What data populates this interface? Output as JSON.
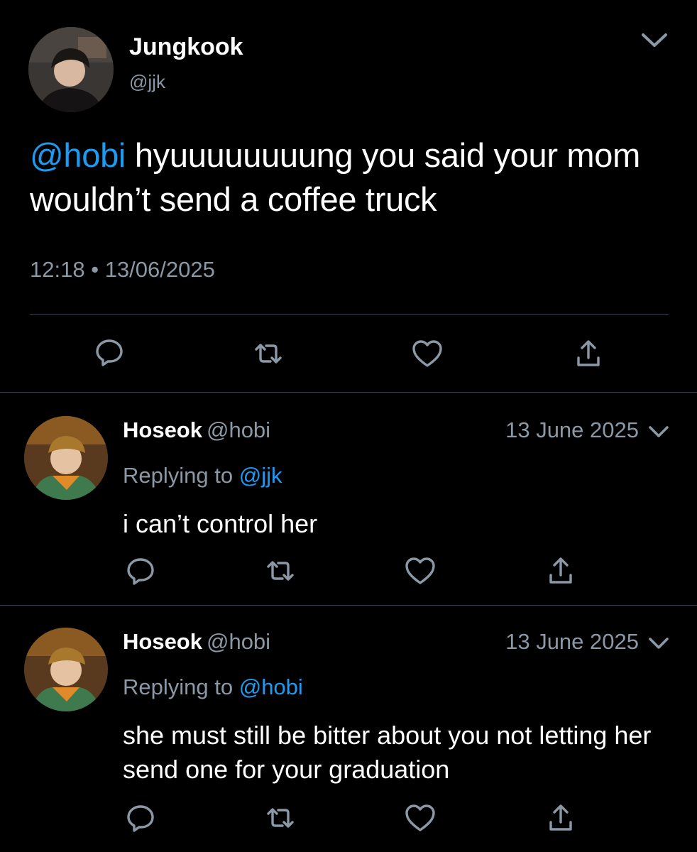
{
  "main_tweet": {
    "display_name": "Jungkook",
    "handle": "@jjk",
    "mention": "@hobi",
    "text_rest": " hyuuuuuuuung you said your mom wouldn’t send a coffee truck",
    "time": "12:18",
    "separator": "•",
    "date": "13/06/2025",
    "menu_icon": "chevron-down-icon",
    "actions": [
      "reply-icon",
      "retweet-icon",
      "like-icon",
      "share-icon"
    ]
  },
  "replies": [
    {
      "display_name": "Hoseok",
      "handle": "@hobi",
      "date": "13 June 2025",
      "replying_label": "Replying to",
      "replying_to": "@jjk",
      "text": "i can’t control her"
    },
    {
      "display_name": "Hoseok",
      "handle": "@hobi",
      "date": "13 June 2025",
      "replying_label": "Replying to",
      "replying_to": "@hobi",
      "text": "she must still be bitter about you not letting her send one for your graduation"
    }
  ],
  "colors": {
    "background": "#000000",
    "text": "#ffffff",
    "secondary": "#8b98a5",
    "accent": "#1d9bf0",
    "divider": "#38444d"
  }
}
